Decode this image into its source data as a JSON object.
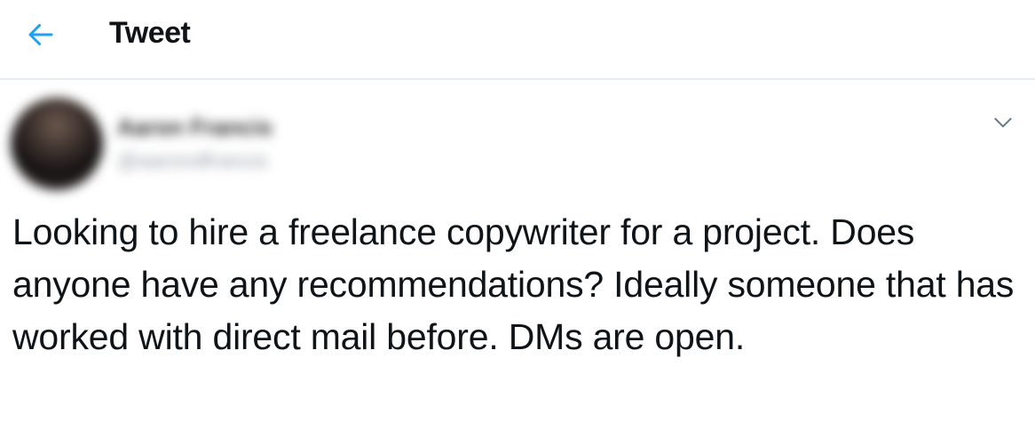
{
  "header": {
    "back_icon": "arrow-left-icon",
    "title": "Tweet",
    "accent_color": "#1da1f2"
  },
  "author": {
    "display_name": "Aaron Francis",
    "handle": "@aarondfrancis",
    "avatar_icon": "avatar",
    "more_icon": "chevron-down-icon"
  },
  "tweet": {
    "text": "Looking to hire a freelance copywriter for a project. Does anyone have any recommendations? Ideally someone that has worked with direct mail before. DMs are open."
  }
}
